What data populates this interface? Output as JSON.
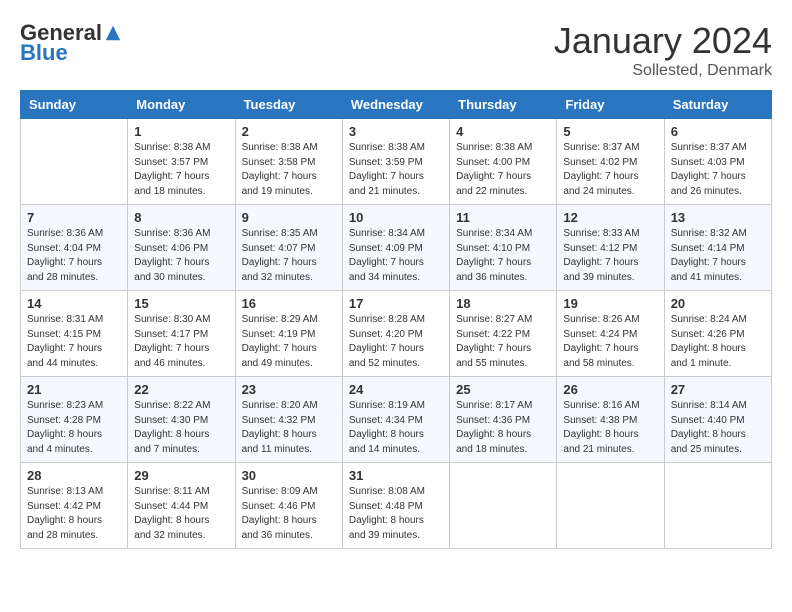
{
  "header": {
    "logo_general": "General",
    "logo_blue": "Blue",
    "month_title": "January 2024",
    "location": "Sollested, Denmark"
  },
  "weekdays": [
    "Sunday",
    "Monday",
    "Tuesday",
    "Wednesday",
    "Thursday",
    "Friday",
    "Saturday"
  ],
  "weeks": [
    [
      {
        "day": "",
        "sunrise": "",
        "sunset": "",
        "daylight": ""
      },
      {
        "day": "1",
        "sunrise": "Sunrise: 8:38 AM",
        "sunset": "Sunset: 3:57 PM",
        "daylight": "Daylight: 7 hours and 18 minutes."
      },
      {
        "day": "2",
        "sunrise": "Sunrise: 8:38 AM",
        "sunset": "Sunset: 3:58 PM",
        "daylight": "Daylight: 7 hours and 19 minutes."
      },
      {
        "day": "3",
        "sunrise": "Sunrise: 8:38 AM",
        "sunset": "Sunset: 3:59 PM",
        "daylight": "Daylight: 7 hours and 21 minutes."
      },
      {
        "day": "4",
        "sunrise": "Sunrise: 8:38 AM",
        "sunset": "Sunset: 4:00 PM",
        "daylight": "Daylight: 7 hours and 22 minutes."
      },
      {
        "day": "5",
        "sunrise": "Sunrise: 8:37 AM",
        "sunset": "Sunset: 4:02 PM",
        "daylight": "Daylight: 7 hours and 24 minutes."
      },
      {
        "day": "6",
        "sunrise": "Sunrise: 8:37 AM",
        "sunset": "Sunset: 4:03 PM",
        "daylight": "Daylight: 7 hours and 26 minutes."
      }
    ],
    [
      {
        "day": "7",
        "sunrise": "Sunrise: 8:36 AM",
        "sunset": "Sunset: 4:04 PM",
        "daylight": "Daylight: 7 hours and 28 minutes."
      },
      {
        "day": "8",
        "sunrise": "Sunrise: 8:36 AM",
        "sunset": "Sunset: 4:06 PM",
        "daylight": "Daylight: 7 hours and 30 minutes."
      },
      {
        "day": "9",
        "sunrise": "Sunrise: 8:35 AM",
        "sunset": "Sunset: 4:07 PM",
        "daylight": "Daylight: 7 hours and 32 minutes."
      },
      {
        "day": "10",
        "sunrise": "Sunrise: 8:34 AM",
        "sunset": "Sunset: 4:09 PM",
        "daylight": "Daylight: 7 hours and 34 minutes."
      },
      {
        "day": "11",
        "sunrise": "Sunrise: 8:34 AM",
        "sunset": "Sunset: 4:10 PM",
        "daylight": "Daylight: 7 hours and 36 minutes."
      },
      {
        "day": "12",
        "sunrise": "Sunrise: 8:33 AM",
        "sunset": "Sunset: 4:12 PM",
        "daylight": "Daylight: 7 hours and 39 minutes."
      },
      {
        "day": "13",
        "sunrise": "Sunrise: 8:32 AM",
        "sunset": "Sunset: 4:14 PM",
        "daylight": "Daylight: 7 hours and 41 minutes."
      }
    ],
    [
      {
        "day": "14",
        "sunrise": "Sunrise: 8:31 AM",
        "sunset": "Sunset: 4:15 PM",
        "daylight": "Daylight: 7 hours and 44 minutes."
      },
      {
        "day": "15",
        "sunrise": "Sunrise: 8:30 AM",
        "sunset": "Sunset: 4:17 PM",
        "daylight": "Daylight: 7 hours and 46 minutes."
      },
      {
        "day": "16",
        "sunrise": "Sunrise: 8:29 AM",
        "sunset": "Sunset: 4:19 PM",
        "daylight": "Daylight: 7 hours and 49 minutes."
      },
      {
        "day": "17",
        "sunrise": "Sunrise: 8:28 AM",
        "sunset": "Sunset: 4:20 PM",
        "daylight": "Daylight: 7 hours and 52 minutes."
      },
      {
        "day": "18",
        "sunrise": "Sunrise: 8:27 AM",
        "sunset": "Sunset: 4:22 PM",
        "daylight": "Daylight: 7 hours and 55 minutes."
      },
      {
        "day": "19",
        "sunrise": "Sunrise: 8:26 AM",
        "sunset": "Sunset: 4:24 PM",
        "daylight": "Daylight: 7 hours and 58 minutes."
      },
      {
        "day": "20",
        "sunrise": "Sunrise: 8:24 AM",
        "sunset": "Sunset: 4:26 PM",
        "daylight": "Daylight: 8 hours and 1 minute."
      }
    ],
    [
      {
        "day": "21",
        "sunrise": "Sunrise: 8:23 AM",
        "sunset": "Sunset: 4:28 PM",
        "daylight": "Daylight: 8 hours and 4 minutes."
      },
      {
        "day": "22",
        "sunrise": "Sunrise: 8:22 AM",
        "sunset": "Sunset: 4:30 PM",
        "daylight": "Daylight: 8 hours and 7 minutes."
      },
      {
        "day": "23",
        "sunrise": "Sunrise: 8:20 AM",
        "sunset": "Sunset: 4:32 PM",
        "daylight": "Daylight: 8 hours and 11 minutes."
      },
      {
        "day": "24",
        "sunrise": "Sunrise: 8:19 AM",
        "sunset": "Sunset: 4:34 PM",
        "daylight": "Daylight: 8 hours and 14 minutes."
      },
      {
        "day": "25",
        "sunrise": "Sunrise: 8:17 AM",
        "sunset": "Sunset: 4:36 PM",
        "daylight": "Daylight: 8 hours and 18 minutes."
      },
      {
        "day": "26",
        "sunrise": "Sunrise: 8:16 AM",
        "sunset": "Sunset: 4:38 PM",
        "daylight": "Daylight: 8 hours and 21 minutes."
      },
      {
        "day": "27",
        "sunrise": "Sunrise: 8:14 AM",
        "sunset": "Sunset: 4:40 PM",
        "daylight": "Daylight: 8 hours and 25 minutes."
      }
    ],
    [
      {
        "day": "28",
        "sunrise": "Sunrise: 8:13 AM",
        "sunset": "Sunset: 4:42 PM",
        "daylight": "Daylight: 8 hours and 28 minutes."
      },
      {
        "day": "29",
        "sunrise": "Sunrise: 8:11 AM",
        "sunset": "Sunset: 4:44 PM",
        "daylight": "Daylight: 8 hours and 32 minutes."
      },
      {
        "day": "30",
        "sunrise": "Sunrise: 8:09 AM",
        "sunset": "Sunset: 4:46 PM",
        "daylight": "Daylight: 8 hours and 36 minutes."
      },
      {
        "day": "31",
        "sunrise": "Sunrise: 8:08 AM",
        "sunset": "Sunset: 4:48 PM",
        "daylight": "Daylight: 8 hours and 39 minutes."
      },
      {
        "day": "",
        "sunrise": "",
        "sunset": "",
        "daylight": ""
      },
      {
        "day": "",
        "sunrise": "",
        "sunset": "",
        "daylight": ""
      },
      {
        "day": "",
        "sunrise": "",
        "sunset": "",
        "daylight": ""
      }
    ]
  ]
}
